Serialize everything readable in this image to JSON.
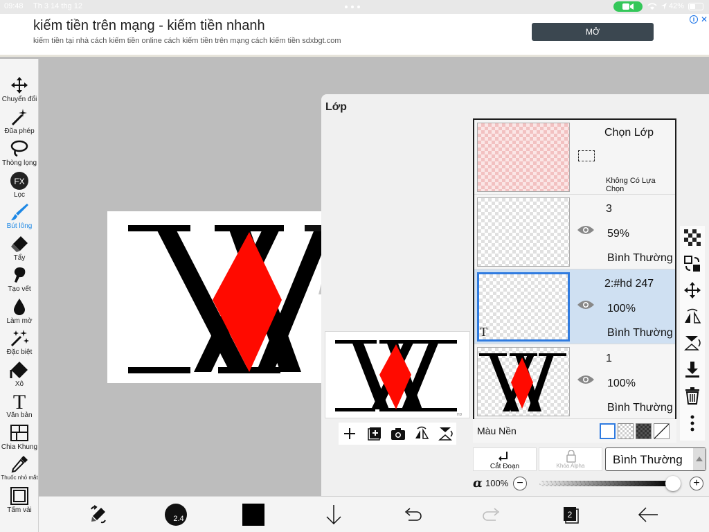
{
  "status_bar": {
    "time": "09:48",
    "date": "Th 3 14 thg 12",
    "battery": "42%"
  },
  "ad": {
    "title": "kiếm tiền trên mạng - kiếm tiền nhanh",
    "description": "kiếm tiền tại nhà cách kiếm tiền online cách kiếm tiền trên mạng cách kiếm tiền sdxbgt.com",
    "open_label": "MỞ",
    "info_label": "i",
    "close_label": "✕"
  },
  "tools": [
    {
      "label": "Chuyển đổi",
      "icon": "move-icon"
    },
    {
      "label": "Đũa phép",
      "icon": "magic-wand-icon"
    },
    {
      "label": "Thòng lọng",
      "icon": "lasso-icon"
    },
    {
      "label": "Lọc",
      "icon": "fx-icon",
      "glyph": "FX"
    },
    {
      "label": "Bút lông",
      "icon": "brush-icon",
      "active": true
    },
    {
      "label": "Tẩy",
      "icon": "eraser-icon"
    },
    {
      "label": "Tạo vết",
      "icon": "smudge-icon"
    },
    {
      "label": "Làm mờ",
      "icon": "blur-icon"
    },
    {
      "label": "Đặc biệt",
      "icon": "special-icon"
    },
    {
      "label": "Xô",
      "icon": "bucket-icon"
    },
    {
      "label": "Văn bản",
      "icon": "text-icon",
      "glyph": "T"
    },
    {
      "label": "Chia Khung",
      "icon": "frame-divider-icon"
    },
    {
      "label": "Thuốc nhỏ mắt",
      "icon": "eyedropper-icon"
    },
    {
      "label": "Tấm vải",
      "icon": "canvas-icon"
    }
  ],
  "layers_panel": {
    "title": "Lớp",
    "selection_layer": {
      "title": "Chọn Lớp",
      "subtitle": "Không Có Lựa Chọn"
    },
    "layers": [
      {
        "name": "3",
        "opacity": "59%",
        "mode": "Bình Thường",
        "selected": false,
        "visible": true
      },
      {
        "name": "2:#hd 247",
        "opacity": "100%",
        "mode": "Bình Thường",
        "selected": true,
        "visible": true,
        "type_badge": "T"
      },
      {
        "name": "1",
        "opacity": "100%",
        "mode": "Bình Thường",
        "selected": false,
        "visible": true
      }
    ],
    "background_label": "Màu Nền",
    "clip_label": "Cắt Đoạn",
    "alpha_lock_label": "Khóa Alpha",
    "blend_mode": "Bình Thường",
    "alpha_symbol": "α",
    "opacity_value": "100%",
    "minus": "−",
    "plus": "+",
    "preview_watermark": "HD"
  },
  "bottom_bar": {
    "brush_size": "2.4",
    "layer_count": "2"
  },
  "colors": {
    "accent": "#1e88e5",
    "selected_layer": "#cfe0f2",
    "logo_red": "#ff0a00",
    "primary_color": "#000000"
  }
}
